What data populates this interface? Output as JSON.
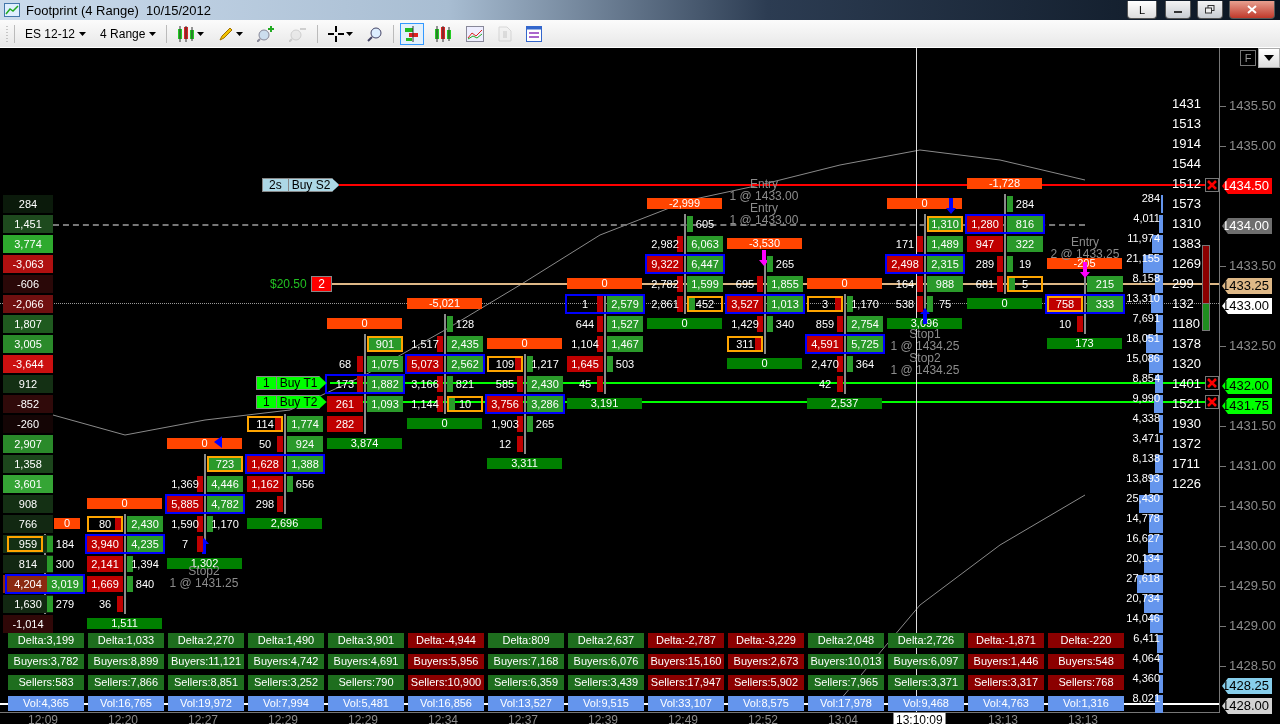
{
  "window": {
    "title": "Footprint (4 Range)  10/15/2012",
    "buttons": [
      "L"
    ]
  },
  "toolbar": {
    "instrument": "ES 12-12",
    "period": "4 Range",
    "tools": [
      {
        "kind": "candles",
        "menu": true,
        "selected": false,
        "disabled": false
      },
      {
        "kind": "pencil",
        "menu": true,
        "selected": false,
        "disabled": false
      },
      {
        "kind": "zoom-in",
        "menu": false,
        "selected": false,
        "disabled": false
      },
      {
        "kind": "zoom-out",
        "menu": false,
        "selected": false,
        "disabled": true
      },
      {
        "kind": "crosshair",
        "menu": true,
        "selected": false,
        "disabled": false
      },
      {
        "kind": "search",
        "menu": false,
        "selected": false,
        "disabled": false
      },
      {
        "kind": "footprint",
        "menu": false,
        "selected": true,
        "disabled": false
      },
      {
        "kind": "candles",
        "menu": false,
        "selected": false,
        "disabled": false
      },
      {
        "kind": "panel",
        "menu": false,
        "selected": false,
        "disabled": false
      },
      {
        "kind": "document",
        "menu": false,
        "selected": false,
        "disabled": true
      },
      {
        "kind": "properties",
        "menu": false,
        "selected": false,
        "disabled": false
      }
    ]
  },
  "chart": {
    "flag_button": "F",
    "delta_profile": [
      {
        "value": "284",
        "color": "#0b1a0b"
      },
      {
        "value": "1,451",
        "color": "#1e4a1e"
      },
      {
        "value": "3,774",
        "color": "#2eaa2e"
      },
      {
        "value": "-3,063",
        "color": "#b01010"
      },
      {
        "value": "-606",
        "color": "#2a0808"
      },
      {
        "value": "-2,066",
        "color": "#701010"
      },
      {
        "value": "1,807",
        "color": "#1f5a1f"
      },
      {
        "value": "3,005",
        "color": "#2a8a2a"
      },
      {
        "value": "-3,644",
        "color": "#cc1010"
      },
      {
        "value": "912",
        "color": "#143014"
      },
      {
        "value": "-852",
        "color": "#300a0a"
      },
      {
        "value": "-260",
        "color": "#140505"
      },
      {
        "value": "2,907",
        "color": "#2a8a2a"
      },
      {
        "value": "1,358",
        "color": "#1c461c"
      },
      {
        "value": "3,601",
        "color": "#35a535"
      },
      {
        "value": "908",
        "color": "#143014"
      },
      {
        "value": "766",
        "color": "#122812"
      },
      {
        "value": "959",
        "color": "#143014"
      },
      {
        "value": "814",
        "color": "#122812"
      },
      {
        "value": "4,204",
        "color": "#8a2a10"
      },
      {
        "value": "1,630",
        "color": "#122812"
      },
      {
        "value": "-1,014",
        "color": "#300808"
      }
    ],
    "bars": [
      {
        "time": "12:09",
        "header": "0",
        "rows": [
          {
            "ask": "184",
            "ask_filled": false,
            "ask_boxed": false,
            "bid_boxed": true,
            "framed": false
          },
          {
            "ask": "300",
            "ask_filled": false,
            "ask_boxed": false,
            "framed": false
          },
          {
            "ask": "3,019",
            "ask_filled": true,
            "ask_boxed": false,
            "framed": true
          },
          {
            "ask": "279",
            "ask_filled": false,
            "ask_boxed": false,
            "framed": false
          }
        ],
        "summary": {
          "delta": "Delta:3,199",
          "buyers": "Buyers:3,782",
          "sellers": "Sellers:583",
          "volume": "Vol:4,365",
          "color": "#1e6e1e"
        }
      },
      {
        "time": "12:20",
        "header": "0",
        "total": "1,511",
        "rows": [
          {
            "bid": "80",
            "bid_filled": false,
            "bid_boxed": true,
            "ask": "2,430",
            "ask_filled": true,
            "ask_boxed": false,
            "framed": false
          },
          {
            "bid": "3,940",
            "bid_filled": true,
            "bid_boxed": false,
            "ask": "4,235",
            "ask_filled": true,
            "ask_boxed": false,
            "framed": true
          },
          {
            "bid": "2,141",
            "bid_filled": true,
            "bid_boxed": false,
            "ask": "1,394",
            "ask_filled": false,
            "ask_boxed": false,
            "framed": false
          },
          {
            "bid": "1,669",
            "bid_filled": true,
            "bid_boxed": false,
            "ask": "840",
            "ask_filled": false,
            "ask_boxed": false,
            "framed": false
          },
          {
            "bid": "36",
            "bid_filled": false,
            "bid_boxed": false,
            "framed": false
          }
        ],
        "summary": {
          "delta": "Delta:1,033",
          "buyers": "Buyers:8,899",
          "sellers": "Sellers:7,866",
          "volume": "Vol:16,765",
          "color": "#1e6e1e"
        }
      },
      {
        "time": "12:27",
        "header": "0",
        "total": "1,302",
        "rows": [
          {
            "ask": "723",
            "ask_filled": true,
            "ask_boxed": true,
            "framed": false
          },
          {
            "bid": "1,369",
            "bid_filled": false,
            "bid_boxed": false,
            "ask": "4,446",
            "ask_filled": true,
            "ask_boxed": false,
            "framed": false
          },
          {
            "bid": "5,885",
            "bid_filled": true,
            "bid_boxed": false,
            "ask": "4,782",
            "ask_filled": true,
            "ask_boxed": false,
            "framed": true
          },
          {
            "bid": "1,590",
            "bid_filled": false,
            "bid_boxed": false,
            "ask": "1,170",
            "ask_filled": false,
            "ask_boxed": false,
            "framed": false
          },
          {
            "bid": "7",
            "bid_filled": false,
            "bid_boxed": false,
            "framed": false
          }
        ],
        "summary": {
          "delta": "Delta:2,270",
          "buyers": "Buyers:11,121",
          "sellers": "Sellers:8,851",
          "volume": "Vol:19,972",
          "color": "#1e6e1e"
        }
      },
      {
        "time": "12:29",
        "total": "2,696",
        "rows": [
          {
            "bid": "114",
            "bid_filled": false,
            "bid_boxed": true,
            "ask": "1,774",
            "ask_filled": true,
            "ask_boxed": false,
            "framed": false
          },
          {
            "bid": "50",
            "bid_filled": false,
            "bid_boxed": false,
            "ask": "924",
            "ask_filled": true,
            "ask_boxed": false,
            "framed": false
          },
          {
            "bid": "1,628",
            "bid_filled": true,
            "bid_boxed": false,
            "ask": "1,388",
            "ask_filled": true,
            "ask_boxed": false,
            "framed": true
          },
          {
            "bid": "1,162",
            "bid_filled": true,
            "bid_boxed": false,
            "ask": "656",
            "ask_filled": false,
            "ask_boxed": false,
            "framed": false
          },
          {
            "bid": "298",
            "bid_filled": false,
            "bid_boxed": false,
            "framed": false
          }
        ],
        "summary": {
          "delta": "Delta:1,490",
          "buyers": "Buyers:4,742",
          "sellers": "Sellers:3,252",
          "volume": "Vol:7,994",
          "color": "#1e6e1e"
        }
      },
      {
        "time": "12:29",
        "header": "0",
        "total": "3,874",
        "rows": [
          {
            "ask": "901",
            "ask_filled": true,
            "ask_boxed": true,
            "framed": false
          },
          {
            "bid": "68",
            "bid_filled": false,
            "bid_boxed": false,
            "ask": "1,075",
            "ask_filled": true,
            "ask_boxed": false,
            "framed": false
          },
          {
            "bid": "173",
            "bid_filled": false,
            "bid_boxed": false,
            "ask": "1,882",
            "ask_filled": true,
            "ask_boxed": false,
            "framed": true
          },
          {
            "bid": "261",
            "bid_filled": true,
            "bid_boxed": false,
            "ask": "1,093",
            "ask_filled": true,
            "ask_boxed": false,
            "framed": false
          },
          {
            "bid": "282",
            "bid_filled": true,
            "bid_boxed": false,
            "framed": false
          }
        ],
        "summary": {
          "delta": "Delta:3,901",
          "buyers": "Buyers:4,691",
          "sellers": "Sellers:790",
          "volume": "Vol:5,481",
          "color": "#1e6e1e"
        }
      },
      {
        "time": "12:34",
        "header": "-5,021",
        "total": "0",
        "rows": [
          {
            "ask": "128",
            "ask_filled": false,
            "ask_boxed": false,
            "framed": false
          },
          {
            "bid": "1,517",
            "bid_filled": false,
            "bid_boxed": false,
            "ask": "2,435",
            "ask_filled": true,
            "ask_boxed": false,
            "framed": false
          },
          {
            "bid": "5,073",
            "bid_filled": true,
            "bid_boxed": false,
            "ask": "2,562",
            "ask_filled": true,
            "ask_boxed": false,
            "framed": true
          },
          {
            "bid": "3,166",
            "bid_filled": false,
            "bid_boxed": false,
            "ask": "821",
            "ask_filled": false,
            "ask_boxed": false,
            "framed": false
          },
          {
            "bid": "1,144",
            "bid_filled": false,
            "bid_boxed": false,
            "ask": "10",
            "ask_filled": false,
            "ask_boxed": true,
            "framed": false
          }
        ],
        "summary": {
          "delta": "Delta:-4,944",
          "buyers": "Buyers:5,956",
          "sellers": "Sellers:10,900",
          "volume": "Vol:16,856",
          "color": "#8b0000"
        }
      },
      {
        "time": "12:37",
        "header": "0",
        "total": "3,311",
        "rows": [
          {
            "bid": "109",
            "bid_filled": false,
            "bid_boxed": true,
            "ask": "1,217",
            "ask_filled": false,
            "ask_boxed": false,
            "framed": false
          },
          {
            "bid": "585",
            "bid_filled": false,
            "bid_boxed": false,
            "ask": "2,430",
            "ask_filled": true,
            "ask_boxed": false,
            "framed": false
          },
          {
            "bid": "3,756",
            "bid_filled": true,
            "bid_boxed": false,
            "ask": "3,286",
            "ask_filled": true,
            "ask_boxed": false,
            "framed": true
          },
          {
            "bid": "1,903",
            "bid_filled": false,
            "bid_boxed": false,
            "ask": "265",
            "ask_filled": false,
            "ask_boxed": false,
            "framed": false
          },
          {
            "bid": "12",
            "bid_filled": false,
            "bid_boxed": false,
            "framed": false
          }
        ],
        "summary": {
          "delta": "Delta:809",
          "buyers": "Buyers:7,168",
          "sellers": "Sellers:6,359",
          "volume": "Vol:13,527",
          "color": "#1e6e1e"
        }
      },
      {
        "time": "12:39",
        "header": "0",
        "total": "3,191",
        "rows": [
          {
            "bid": "1",
            "bid_filled": false,
            "bid_boxed": false,
            "ask": "2,579",
            "ask_filled": true,
            "ask_boxed": false,
            "framed": true
          },
          {
            "bid": "644",
            "bid_filled": false,
            "bid_boxed": false,
            "ask": "1,527",
            "ask_filled": true,
            "ask_boxed": false,
            "framed": false
          },
          {
            "bid": "1,104",
            "bid_filled": false,
            "bid_boxed": false,
            "ask": "1,467",
            "ask_filled": true,
            "ask_boxed": false,
            "framed": false
          },
          {
            "bid": "1,645",
            "bid_filled": true,
            "bid_boxed": false,
            "ask": "503",
            "ask_filled": false,
            "ask_boxed": false,
            "framed": false
          },
          {
            "bid": "45",
            "bid_filled": false,
            "bid_boxed": false,
            "framed": false
          }
        ],
        "summary": {
          "delta": "Delta:2,637",
          "buyers": "Buyers:6,076",
          "sellers": "Sellers:3,439",
          "volume": "Vol:9,515",
          "color": "#1e6e1e"
        }
      },
      {
        "time": "12:49",
        "header": "-2,999",
        "total": "0",
        "rows": [
          {
            "ask": "605",
            "ask_filled": false,
            "ask_boxed": false,
            "framed": false
          },
          {
            "bid": "2,982",
            "bid_filled": false,
            "bid_boxed": false,
            "ask": "6,063",
            "ask_filled": true,
            "ask_boxed": false,
            "framed": false
          },
          {
            "bid": "9,322",
            "bid_filled": true,
            "bid_boxed": false,
            "ask": "6,447",
            "ask_filled": true,
            "ask_boxed": false,
            "framed": true
          },
          {
            "bid": "2,782",
            "bid_filled": false,
            "bid_boxed": false,
            "ask": "1,599",
            "ask_filled": true,
            "ask_boxed": false,
            "framed": false
          },
          {
            "bid": "2,861",
            "bid_filled": false,
            "bid_boxed": false,
            "ask": "452",
            "ask_filled": false,
            "ask_boxed": true,
            "framed": false
          }
        ],
        "summary": {
          "delta": "Delta:-2,787",
          "buyers": "Buyers:15,160",
          "sellers": "Sellers:17,947",
          "volume": "Vol:33,107",
          "color": "#8b0000"
        }
      },
      {
        "time": "12:52",
        "header": "-3,530",
        "total": "0",
        "rows": [
          {
            "ask": "265",
            "ask_filled": false,
            "ask_boxed": false,
            "framed": false
          },
          {
            "bid": "695",
            "bid_filled": false,
            "bid_boxed": false,
            "ask": "1,855",
            "ask_filled": true,
            "ask_boxed": false,
            "framed": false
          },
          {
            "bid": "3,527",
            "bid_filled": true,
            "bid_boxed": false,
            "ask": "1,013",
            "ask_filled": true,
            "ask_boxed": false,
            "framed": true
          },
          {
            "bid": "1,429",
            "bid_filled": false,
            "bid_boxed": false,
            "ask": "340",
            "ask_filled": false,
            "ask_boxed": false,
            "framed": false
          },
          {
            "bid": "311",
            "bid_filled": false,
            "bid_boxed": true,
            "framed": false
          }
        ],
        "summary": {
          "delta": "Delta:-3,229",
          "buyers": "Buyers:2,673",
          "sellers": "Sellers:5,902",
          "volume": "Vol:8,575",
          "color": "#8b0000"
        }
      },
      {
        "time": "13:04",
        "header": "0",
        "total": "2,537",
        "rows": [
          {
            "bid": "3",
            "bid_filled": false,
            "bid_boxed": true,
            "ask": "1,170",
            "ask_filled": false,
            "ask_boxed": false,
            "framed": false
          },
          {
            "bid": "859",
            "bid_filled": false,
            "bid_boxed": false,
            "ask": "2,754",
            "ask_filled": true,
            "ask_boxed": false,
            "framed": false
          },
          {
            "bid": "4,591",
            "bid_filled": true,
            "bid_boxed": false,
            "ask": "5,725",
            "ask_filled": true,
            "ask_boxed": false,
            "framed": true
          },
          {
            "bid": "2,470",
            "bid_filled": false,
            "bid_boxed": false,
            "ask": "364",
            "ask_filled": false,
            "ask_boxed": false,
            "framed": false
          },
          {
            "bid": "42",
            "bid_filled": false,
            "bid_boxed": false,
            "framed": false
          }
        ],
        "summary": {
          "delta": "Delta:2,048",
          "buyers": "Buyers:10,013",
          "sellers": "Sellers:7,965",
          "volume": "Vol:17,978",
          "color": "#1e6e1e"
        }
      },
      {
        "header": "0",
        "total": "3,096",
        "rows": [
          {
            "ask": "1,310",
            "ask_filled": true,
            "ask_boxed": true,
            "framed": false
          },
          {
            "bid": "171",
            "bid_filled": false,
            "bid_boxed": false,
            "ask": "1,489",
            "ask_filled": true,
            "ask_boxed": false,
            "framed": false
          },
          {
            "bid": "2,498",
            "bid_filled": true,
            "bid_boxed": false,
            "ask": "2,315",
            "ask_filled": true,
            "ask_boxed": false,
            "framed": true
          },
          {
            "bid": "164",
            "bid_filled": false,
            "bid_boxed": false,
            "ask": "988",
            "ask_filled": true,
            "ask_boxed": false,
            "framed": false
          },
          {
            "bid": "538",
            "bid_filled": false,
            "bid_boxed": false,
            "ask": "75",
            "ask_filled": false,
            "ask_boxed": false,
            "framed": false
          }
        ],
        "summary": {
          "delta": "Delta:2,726",
          "buyers": "Buyers:6,097",
          "sellers": "Sellers:3,371",
          "volume": "Vol:9,468",
          "color": "#1e6e1e"
        }
      },
      {
        "time": "13:13",
        "header": "-1,728",
        "total": "0",
        "rows": [
          {
            "ask": "284",
            "ask_filled": false,
            "ask_boxed": false,
            "framed": false
          },
          {
            "bid": "1,280",
            "bid_filled": true,
            "bid_boxed": false,
            "ask": "816",
            "ask_filled": true,
            "ask_boxed": false,
            "framed": true
          },
          {
            "bid": "947",
            "bid_filled": true,
            "bid_boxed": false,
            "ask": "322",
            "ask_filled": true,
            "ask_boxed": false,
            "framed": false
          },
          {
            "bid": "289",
            "bid_filled": false,
            "bid_boxed": false,
            "ask": "19",
            "ask_filled": false,
            "ask_boxed": false,
            "framed": false
          },
          {
            "bid": "681",
            "bid_filled": false,
            "bid_boxed": false,
            "ask": "5",
            "ask_filled": false,
            "ask_boxed": true,
            "framed": false
          }
        ],
        "summary": {
          "delta": "Delta:-1,871",
          "buyers": "Buyers:1,446",
          "sellers": "Sellers:3,317",
          "volume": "Vol:4,763",
          "color": "#8b0000"
        }
      },
      {
        "time": "13:13",
        "header": "-205",
        "total": "173",
        "rows": [
          {
            "ask": "215",
            "ask_filled": true,
            "ask_boxed": false,
            "framed": false
          },
          {
            "bid": "758",
            "bid_filled": true,
            "bid_boxed": true,
            "ask": "333",
            "ask_filled": true,
            "ask_boxed": false,
            "framed": true
          },
          {
            "bid": "10",
            "bid_filled": false,
            "bid_boxed": false,
            "framed": false
          }
        ],
        "summary": {
          "delta": "Delta:-220",
          "buyers": "Buyers:548",
          "sellers": "Sellers:768",
          "volume": "Vol:1,316",
          "color": "#8b0000"
        }
      }
    ],
    "volume_profile": [
      "284",
      "4,011",
      "11,974",
      "21,155",
      "8,158",
      "13,310",
      "7,691",
      "18,051",
      "15,086",
      "8,854",
      "9,990",
      "4,338",
      "3,471",
      "8,138",
      "13,893",
      "25,430",
      "14,778",
      "16,627",
      "20,134",
      "27,618",
      "20,734",
      "14,046",
      "6,411",
      "4,064",
      "4,360",
      "8,021"
    ],
    "price_column": [
      "1431",
      "1513",
      "1914",
      "1544",
      "1512",
      "1573",
      "1310",
      "1383",
      "1269",
      "299",
      "132",
      "1180",
      "1378",
      "1320",
      "1401",
      "1521",
      "1930",
      "1372",
      "1711",
      "1226"
    ],
    "orders": [
      {
        "quantity": "2s",
        "label": "Buy S2",
        "color": "#ff0000",
        "kind": "stop"
      },
      {
        "quantity": "1",
        "label": "Buy T1",
        "color": "#00ff00",
        "kind": "target"
      },
      {
        "quantity": "1",
        "label": "Buy T2",
        "color": "#00ff00",
        "kind": "target"
      }
    ],
    "position": {
      "profit": "$20.50",
      "quantity": "2"
    },
    "annotations": [
      {
        "label": "Stop2",
        "detail": "1 @ 1431.25"
      },
      {
        "label": "Entry",
        "detail": "1 @ 1433.00"
      },
      {
        "label": "Entry",
        "detail": "1 @ 1433.00"
      },
      {
        "label": "Stop1",
        "detail": "1 @ 1434.25"
      },
      {
        "label": "Stop2",
        "detail": "1 @ 1434.25"
      },
      {
        "label": "Entry",
        "detail": "2 @ 1433.25"
      }
    ],
    "markers": [
      {
        "kind": "up",
        "color": "#0000ff"
      },
      {
        "kind": "left",
        "color": "#0000ff"
      },
      {
        "kind": "down",
        "color": "#ff00ff"
      },
      {
        "kind": "down",
        "color": "#0000ff"
      },
      {
        "kind": "up",
        "color": "#0000ff"
      },
      {
        "kind": "down",
        "color": "#ff00ff"
      }
    ],
    "price_axis": [
      {
        "label": "1435.50",
        "kind": "tick"
      },
      {
        "label": "1435.00",
        "kind": "tick"
      },
      {
        "label": "1434.50",
        "kind": "tag",
        "color": "#ff0000"
      },
      {
        "label": "1434.00",
        "kind": "tag",
        "color": "#6e6e6e"
      },
      {
        "label": "1433.50",
        "kind": "tick"
      },
      {
        "label": "1433.25",
        "kind": "tag",
        "color": "#deb887"
      },
      {
        "label": "1433.00",
        "kind": "tag",
        "color": "#ffffff"
      },
      {
        "label": "1432.50",
        "kind": "tick"
      },
      {
        "label": "1432.00",
        "kind": "tag",
        "color": "#00ff00"
      },
      {
        "label": "1431.75",
        "kind": "tag",
        "color": "#00ff00"
      },
      {
        "label": "1431.50",
        "kind": "tick"
      },
      {
        "label": "1431.00",
        "kind": "tick"
      },
      {
        "label": "1430.50",
        "kind": "tick"
      },
      {
        "label": "1430.00",
        "kind": "tick"
      },
      {
        "label": "1429.50",
        "kind": "tick"
      },
      {
        "label": "1429.00",
        "kind": "tick"
      },
      {
        "label": "1428.50",
        "kind": "tick"
      },
      {
        "label": "1428.25",
        "kind": "tag",
        "color": "#87ceeb"
      },
      {
        "label": "1428.00",
        "kind": "tag",
        "color": "#d3d3d3"
      }
    ],
    "crosshair": {
      "time": "13:10:09"
    }
  }
}
